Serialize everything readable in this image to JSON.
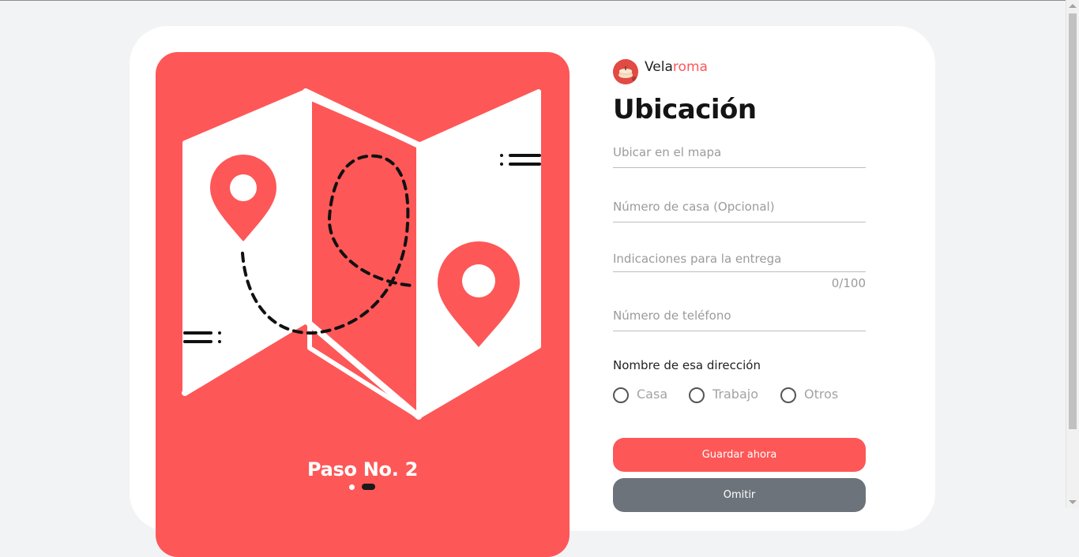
{
  "brand": {
    "name_part1": "Vela",
    "name_part2": "roma",
    "accent_color": "#fe5757"
  },
  "illustration": {
    "step_label": "Paso No. 2",
    "active_step": 2,
    "total_steps": 2,
    "background_color": "#fe5757"
  },
  "form": {
    "title": "Ubicación",
    "map_field": {
      "placeholder": "Ubicar en el mapa"
    },
    "house_number": {
      "placeholder": "Número de casa (Opcional)"
    },
    "instructions": {
      "placeholder": "Indicaciones para la entrega",
      "counter": "0/100"
    },
    "phone": {
      "placeholder": "Número de teléfono"
    },
    "address_name": {
      "label": "Nombre de esa dirección",
      "options": [
        {
          "label": "Casa",
          "selected": false
        },
        {
          "label": "Trabajo",
          "selected": false
        },
        {
          "label": "Otros",
          "selected": false
        }
      ]
    },
    "save_button": {
      "label": "Guardar ahora",
      "color": "#fe5757"
    },
    "skip_button": {
      "label": "Omitir",
      "color": "#6c737b"
    }
  }
}
